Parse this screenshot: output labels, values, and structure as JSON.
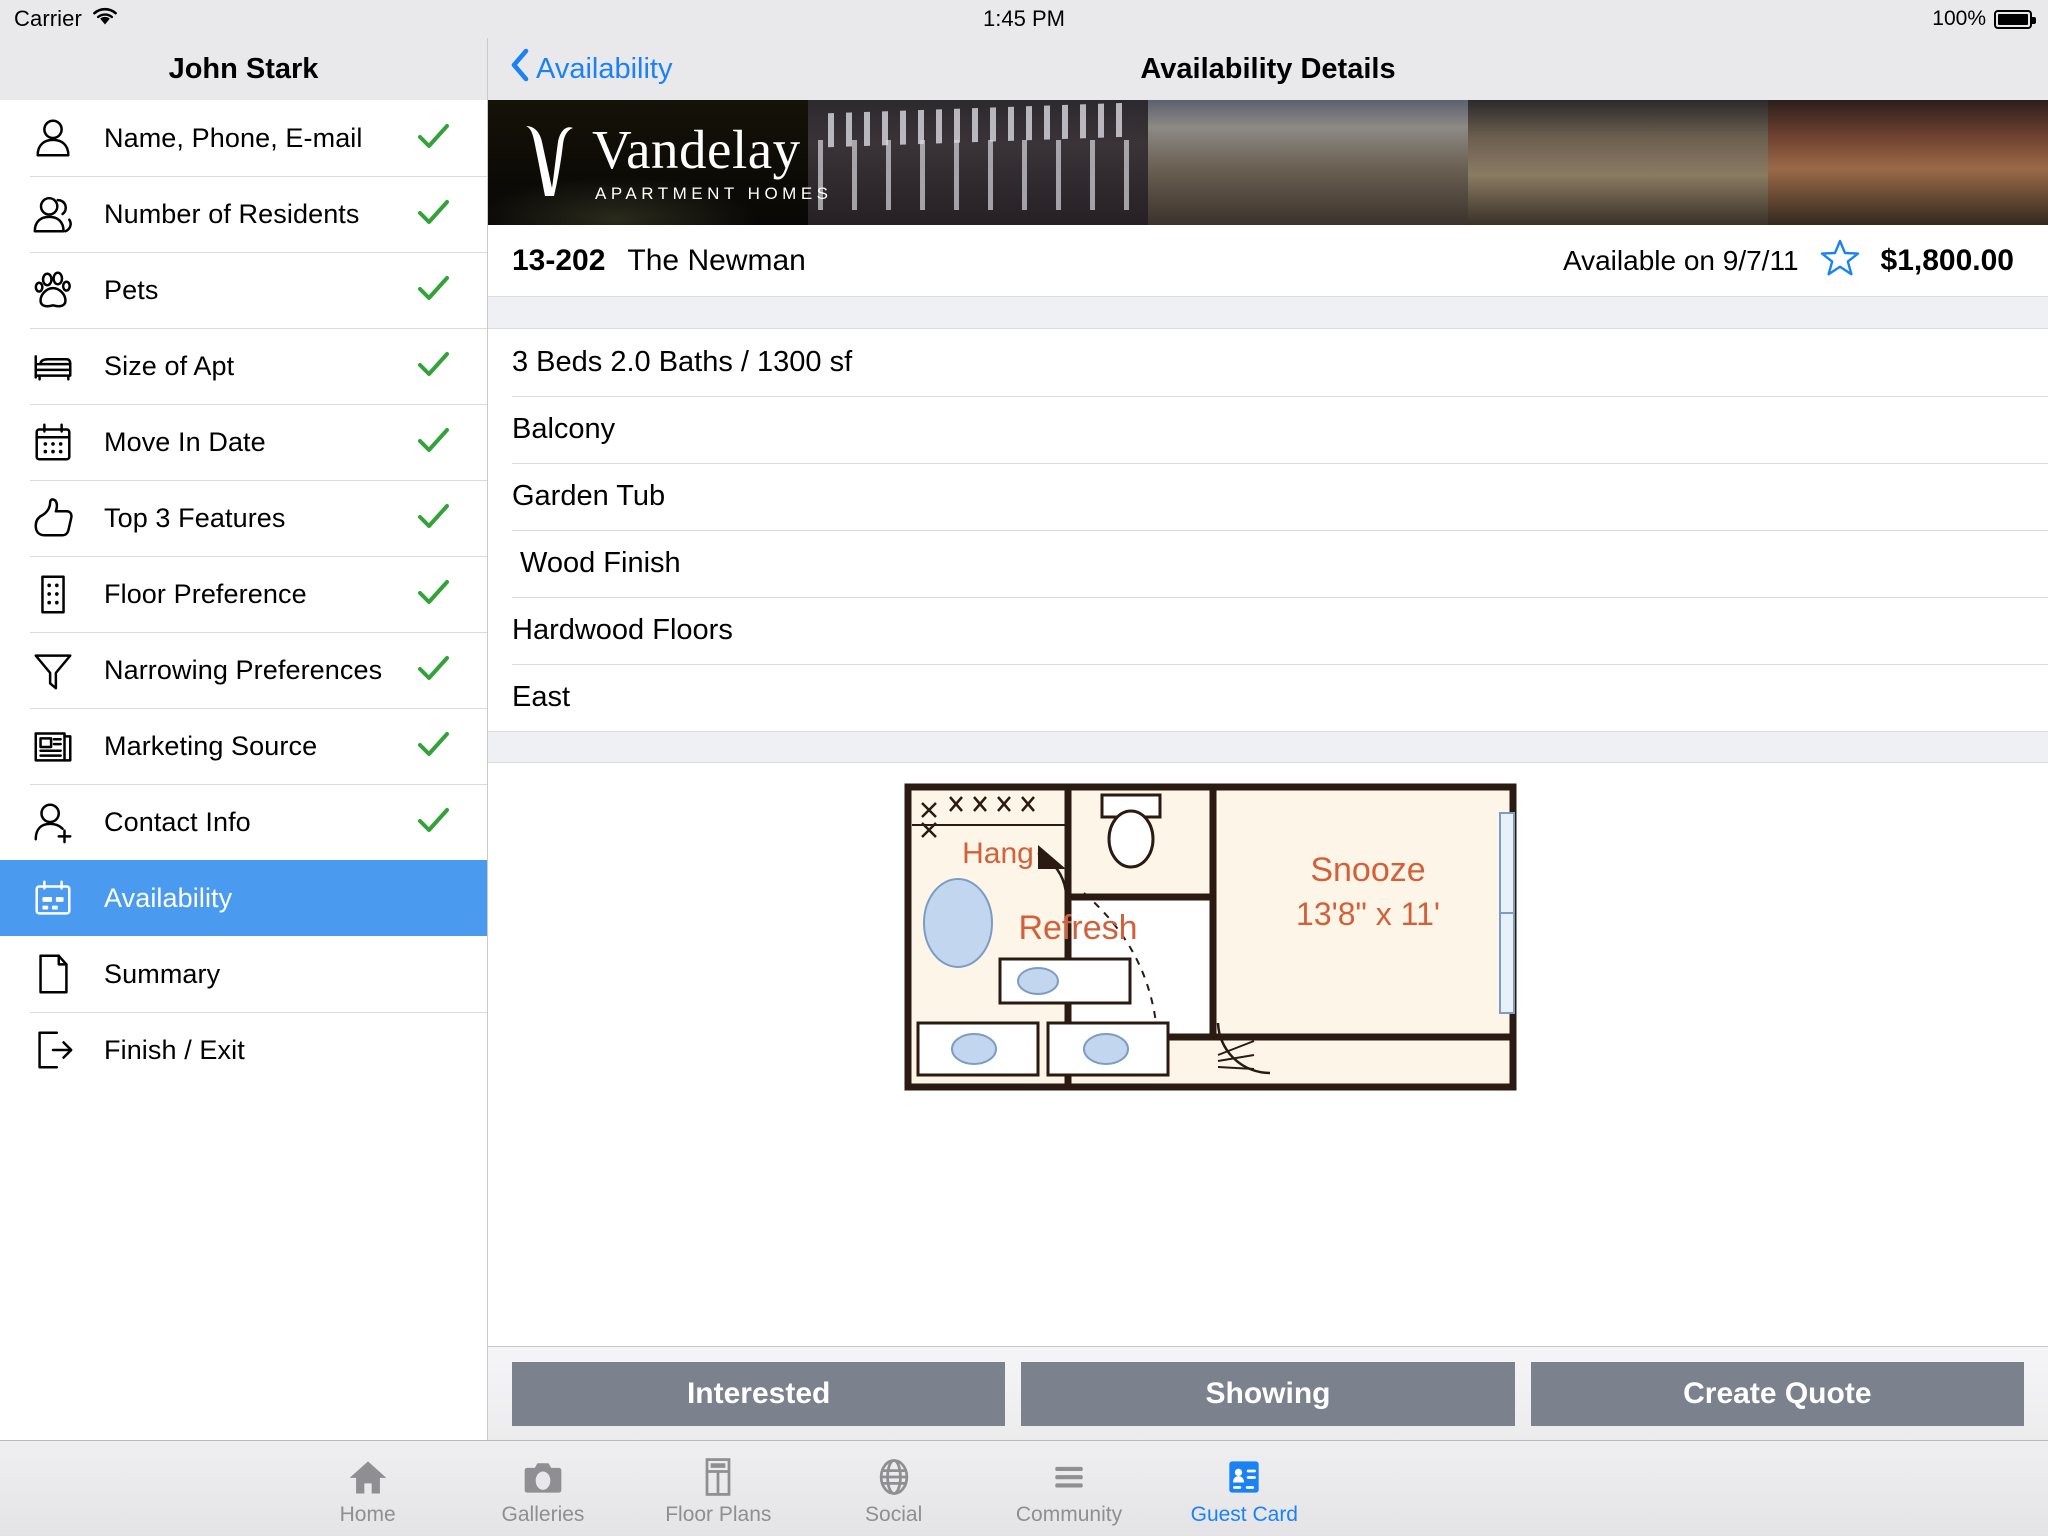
{
  "status_bar": {
    "carrier": "Carrier",
    "wifi_icon": "wifi-icon",
    "time": "1:45 PM",
    "battery_pct": "100%",
    "battery_icon": "battery-full-icon"
  },
  "sidebar": {
    "title": "John Stark",
    "items": [
      {
        "label": "Name, Phone, E-mail",
        "icon": "person-icon",
        "checked": true,
        "selected": false
      },
      {
        "label": "Number of Residents",
        "icon": "people-icon",
        "checked": true,
        "selected": false
      },
      {
        "label": "Pets",
        "icon": "paw-icon",
        "checked": true,
        "selected": false
      },
      {
        "label": "Size of Apt",
        "icon": "bed-icon",
        "checked": true,
        "selected": false
      },
      {
        "label": "Move In Date",
        "icon": "calendar-icon",
        "checked": true,
        "selected": false
      },
      {
        "label": "Top 3 Features",
        "icon": "thumbs-up-icon",
        "checked": true,
        "selected": false
      },
      {
        "label": "Floor Preference",
        "icon": "building-icon",
        "checked": true,
        "selected": false
      },
      {
        "label": "Narrowing Preferences",
        "icon": "funnel-icon",
        "checked": true,
        "selected": false
      },
      {
        "label": "Marketing Source",
        "icon": "newspaper-icon",
        "checked": true,
        "selected": false
      },
      {
        "label": "Contact Info",
        "icon": "person-add-icon",
        "checked": true,
        "selected": false
      },
      {
        "label": "Availability",
        "icon": "availability-card-icon",
        "checked": false,
        "selected": true
      },
      {
        "label": "Summary",
        "icon": "document-icon",
        "checked": false,
        "selected": false
      },
      {
        "label": "Finish / Exit",
        "icon": "exit-icon",
        "checked": false,
        "selected": false
      }
    ],
    "check_color": "#33a23a",
    "selected_color": "#4a9bf0"
  },
  "detail": {
    "back_label": "Availability",
    "back_icon": "chevron-left-icon",
    "title": "Availability Details",
    "accent_color": "#1b82f5",
    "banner": {
      "logo_name": "Vandelay",
      "logo_sub": "APARTMENT HOMES",
      "logo_mark": "vandelay-v-icon"
    },
    "unit": {
      "number": "13-202",
      "name": "The Newman",
      "availability": "Available on 9/7/11",
      "favorite_icon": "star-outline-icon",
      "price": "$1,800.00"
    },
    "features": [
      "3 Beds 2.0 Baths / 1300 sf",
      "Balcony",
      "Garden Tub",
      " Wood Finish",
      "Hardwood Floors",
      "East"
    ],
    "floorplan": {
      "rooms": [
        {
          "name": "Snooze",
          "dims": "13'8\" x 11'"
        },
        {
          "name": "Refresh",
          "dims": ""
        },
        {
          "name": "Hang",
          "dims": ""
        }
      ],
      "label_color": "#d2613a",
      "wall_color": "#2b1a12",
      "fill_color": "#fdf6e8"
    },
    "actions": [
      {
        "label": "Interested",
        "name": "interested-button"
      },
      {
        "label": "Showing",
        "name": "showing-button"
      },
      {
        "label": "Create Quote",
        "name": "create-quote-button"
      }
    ]
  },
  "tabbar": {
    "tabs": [
      {
        "label": "Home",
        "icon": "home-icon",
        "active": false
      },
      {
        "label": "Galleries",
        "icon": "camera-icon",
        "active": false
      },
      {
        "label": "Floor Plans",
        "icon": "floorplan-icon",
        "active": false
      },
      {
        "label": "Social",
        "icon": "globe-icon",
        "active": false
      },
      {
        "label": "Community",
        "icon": "list-lines-icon",
        "active": false
      },
      {
        "label": "Guest Card",
        "icon": "guest-card-icon",
        "active": true
      }
    ],
    "active_color": "#1b82f5",
    "inactive_color": "#8e8e93"
  }
}
